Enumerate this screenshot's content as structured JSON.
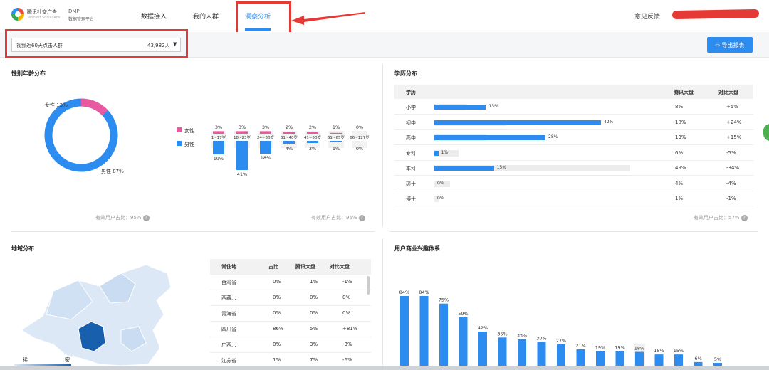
{
  "header": {
    "brand_cn": "腾讯社交广告",
    "brand_en": "Tencent Social Ads",
    "product": "DMP",
    "product_sub": "数据管理平台",
    "tabs": [
      {
        "label": "数据接入",
        "active": false
      },
      {
        "label": "我的人群",
        "active": false
      },
      {
        "label": "洞察分析",
        "active": true
      }
    ],
    "feedback": "意见反馈"
  },
  "filter": {
    "audience": "视频近60天点击人群",
    "count": "43,982人",
    "export_label": "导出报表"
  },
  "gender_age": {
    "title": "性别年龄分布",
    "female_label": "女性 13%",
    "male_label": "男性 87%",
    "female_pct": 13,
    "male_pct": 87,
    "legend_female": "女性",
    "legend_male": "男性",
    "age_groups": [
      {
        "range": "1~17岁",
        "female": "3%",
        "male": "19%",
        "female_val": 3,
        "male_val": 19
      },
      {
        "range": "18~23岁",
        "female": "3%",
        "male": "41%",
        "female_val": 3,
        "male_val": 41
      },
      {
        "range": "24~30岁",
        "female": "3%",
        "male": "18%",
        "female_val": 3,
        "male_val": 18
      },
      {
        "range": "31~40岁",
        "female": "2%",
        "male": "4%",
        "female_val": 2,
        "male_val": 4
      },
      {
        "range": "41~50岁",
        "female": "2%",
        "male": "3%",
        "female_val": 2,
        "male_val": 3
      },
      {
        "range": "51~65岁",
        "female": "1%",
        "male": "1%",
        "female_val": 1,
        "male_val": 1
      },
      {
        "range": "66~127岁",
        "female": "0%",
        "male": "0%",
        "female_val": 0,
        "male_val": 0
      }
    ],
    "valid_left": "有效用户占比：95%",
    "valid_right": "有效用户占比：96%",
    "female_color": "#e85aa0",
    "male_color": "#2d8cf0"
  },
  "education": {
    "title": "学历分布",
    "headers": [
      "学历",
      "腾讯大盘",
      "对比大盘"
    ],
    "rows": [
      {
        "name": "小学",
        "pct": "13%",
        "val": 13,
        "market": "8%",
        "market_val": 8,
        "diff": "+5%"
      },
      {
        "name": "初中",
        "pct": "42%",
        "val": 42,
        "market": "18%",
        "market_val": 18,
        "diff": "+24%"
      },
      {
        "name": "高中",
        "pct": "28%",
        "val": 28,
        "market": "13%",
        "market_val": 13,
        "diff": "+15%"
      },
      {
        "name": "专科",
        "pct": "1%",
        "val": 1,
        "market": "6%",
        "market_val": 6,
        "diff": "-5%"
      },
      {
        "name": "本科",
        "pct": "15%",
        "val": 15,
        "market": "49%",
        "market_val": 49,
        "diff": "-34%"
      },
      {
        "name": "硕士",
        "pct": "0%",
        "val": 0,
        "market": "4%",
        "market_val": 4,
        "diff": "-4%"
      },
      {
        "name": "博士",
        "pct": "0%",
        "val": 0,
        "market": "1%",
        "market_val": 1,
        "diff": "-1%"
      }
    ],
    "valid": "有效用户占比：57%"
  },
  "region": {
    "title": "地域分布",
    "legend_low": "稀",
    "legend_high": "密",
    "headers": [
      "常住地",
      "占比",
      "腾讯大盘",
      "对比大盘"
    ],
    "rows": [
      {
        "name": "台湾省",
        "pct": "0%",
        "market": "1%",
        "diff": "-1%"
      },
      {
        "name": "西藏...",
        "pct": "0%",
        "market": "0%",
        "diff": "0%"
      },
      {
        "name": "青海省",
        "pct": "0%",
        "market": "0%",
        "diff": "0%"
      },
      {
        "name": "四川省",
        "pct": "86%",
        "market": "5%",
        "diff": "+81%"
      },
      {
        "name": "广西...",
        "pct": "0%",
        "market": "3%",
        "diff": "-3%"
      },
      {
        "name": "江苏省",
        "pct": "1%",
        "market": "7%",
        "diff": "-6%"
      }
    ]
  },
  "interests": {
    "title": "用户商业兴趣体系",
    "values": [
      84,
      84,
      75,
      59,
      42,
      35,
      33,
      30,
      27,
      21,
      19,
      19,
      18,
      15,
      15,
      6,
      5
    ],
    "labels": [
      "84%",
      "84%",
      "75%",
      "59%",
      "42%",
      "35%",
      "33%",
      "30%",
      "27%",
      "21%",
      "19%",
      "19%",
      "18%",
      "15%",
      "15%",
      "6%",
      "5%"
    ]
  },
  "colors": {
    "accent": "#2d8cf0",
    "annotation_red": "#e53935",
    "female": "#e85aa0"
  }
}
